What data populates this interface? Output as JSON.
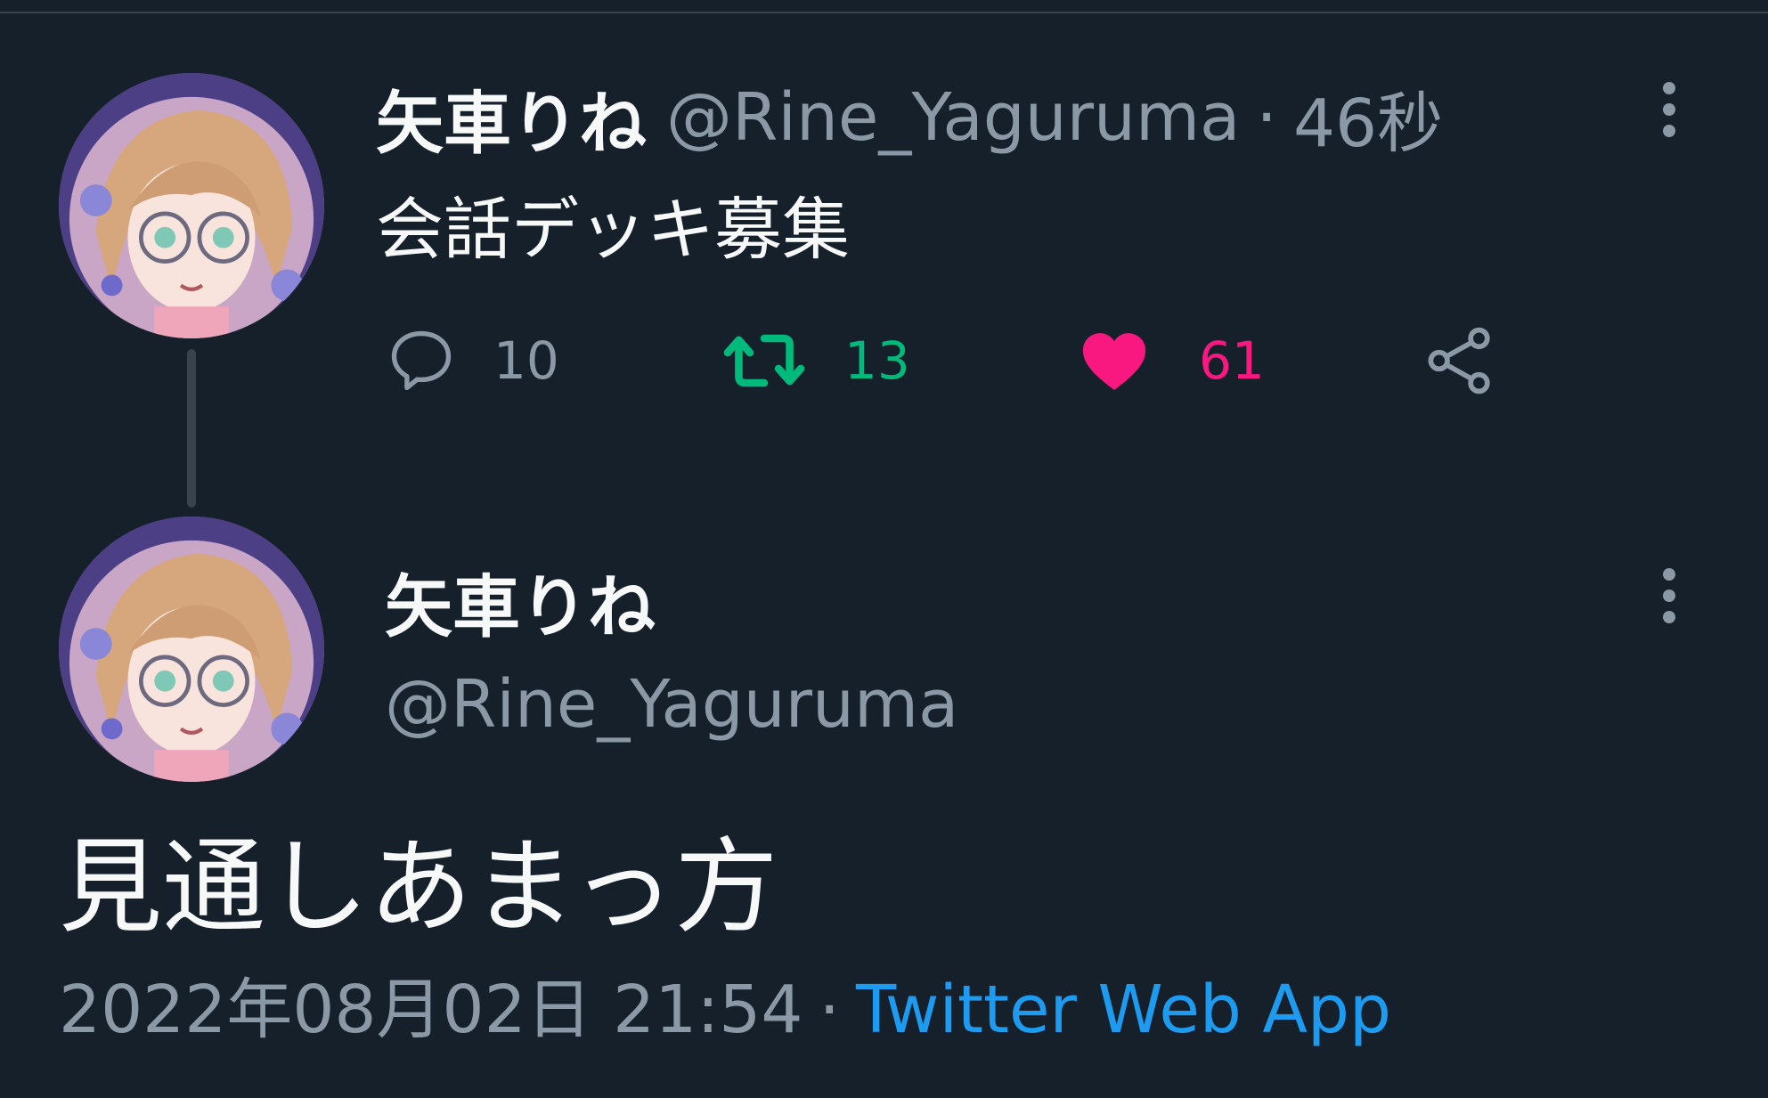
{
  "colors": {
    "background": "#15202b",
    "muted": "#8b98a5",
    "retweet": "#00ba7c",
    "like": "#f91880",
    "link": "#1d9bf0",
    "divider": "#38444d"
  },
  "tweet1": {
    "name": "矢車りね",
    "handle": "@Rine_Yaguruma",
    "separator": "·",
    "time": "46秒",
    "text": "会話デッキ募集",
    "actions": {
      "reply": {
        "icon": "reply-icon",
        "count": "10"
      },
      "retweet": {
        "icon": "retweet-icon",
        "count": "13",
        "active": true
      },
      "like": {
        "icon": "heart-icon",
        "count": "61",
        "active": true
      },
      "share": {
        "icon": "share-icon"
      }
    },
    "more_icon": "more-vertical-icon"
  },
  "tweet2": {
    "name": "矢車りね",
    "handle": "@Rine_Yaguruma",
    "text": "見通しあまっ方",
    "datetime": "2022年08月02日 21:54",
    "separator": "·",
    "source": "Twitter Web App",
    "more_icon": "more-vertical-icon"
  }
}
